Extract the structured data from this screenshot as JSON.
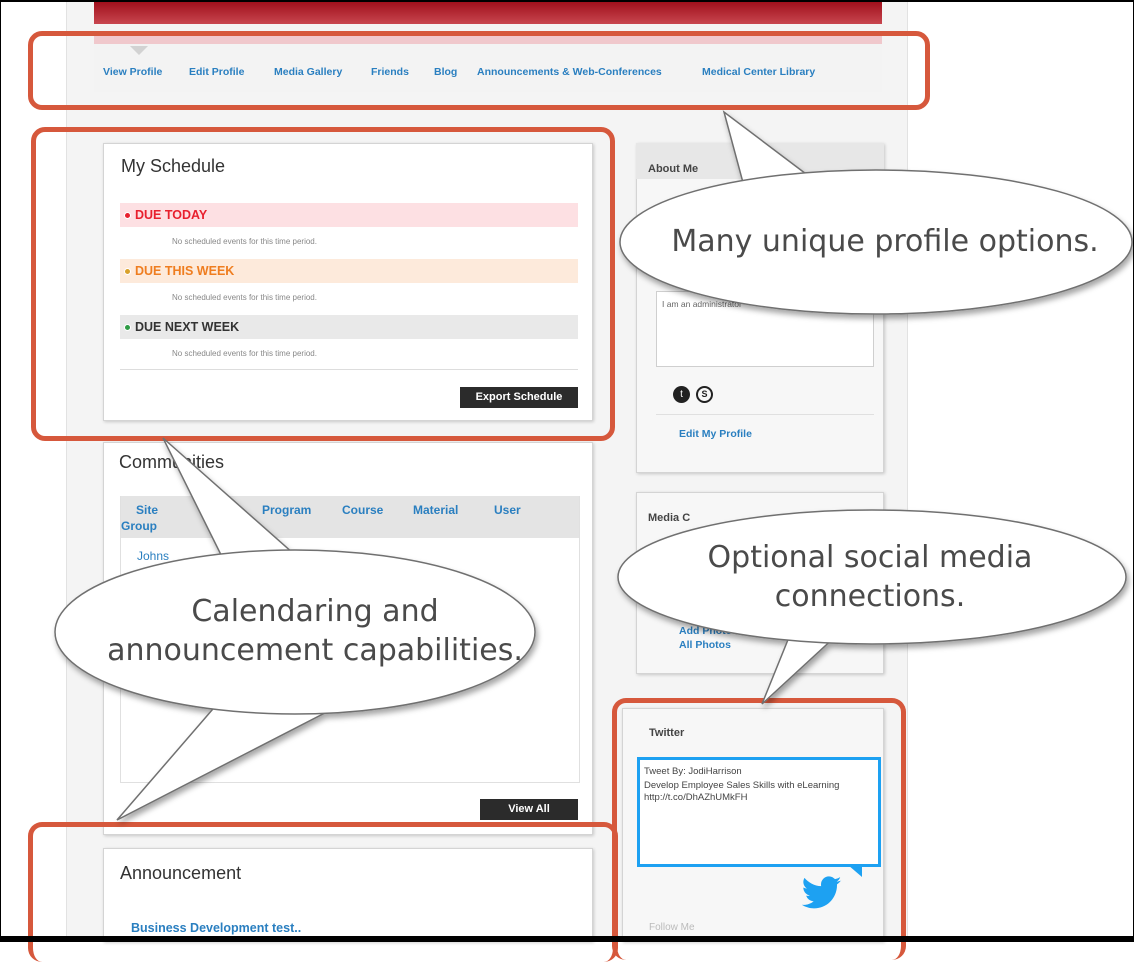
{
  "nav": {
    "items": [
      "View Profile",
      "Edit Profile",
      "Media Gallery",
      "Friends",
      "Blog",
      "Announcements & Web-Conferences",
      "Medical Center Library"
    ]
  },
  "schedule": {
    "title": "My Schedule",
    "due_today": "DUE TODAY",
    "due_this_week": "DUE THIS WEEK",
    "due_next_week": "DUE NEXT WEEK",
    "no_events": "No scheduled events for this time period.",
    "export_label": "Export Schedule"
  },
  "communities": {
    "title": "Communities",
    "tabs": [
      "Site",
      "Program",
      "Course",
      "Material",
      "User"
    ],
    "tab_second_line": "Group",
    "first_item": "Johns",
    "view_all_label": "View All"
  },
  "announcement": {
    "title": "Announcement",
    "first_link": "Business Development test.."
  },
  "about": {
    "title": "About Me",
    "bio": "I am an administrator",
    "edit_link": "Edit My Profile"
  },
  "media": {
    "title": "Media C",
    "add_photo": "Add Photo",
    "all_photos": "All Photos"
  },
  "twitter": {
    "title": "Twitter",
    "tweet_by": "Tweet By: JodiHarrison",
    "tweet_text": "Develop Employee Sales Skills with eLearning http://t.co/DhAZhUMkFH",
    "follow": "Follow Me"
  },
  "callouts": {
    "profile": "Many unique profile options.",
    "social": "Optional social media connections.",
    "calendar": "Calendaring and announcement capabilities."
  },
  "colors": {
    "accent_callout": "#d6583c",
    "link": "#2a7fc0",
    "due_today": "#e8202e",
    "due_week": "#ef7d1f",
    "due_next": "#333333",
    "twitter_blue": "#1da1f2"
  }
}
